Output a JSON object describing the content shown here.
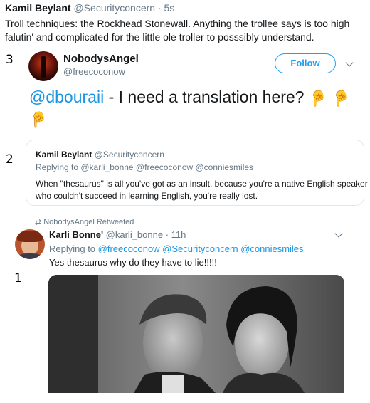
{
  "header": {
    "name": "Kamil Beylant",
    "handle": "@Securityconcern",
    "time": "· 5s",
    "text_line1": "Troll techniques: the Rockhead Stonewall.  Anything the trollee says is too high",
    "text_line2": "falutin' and complicated for the little ole troller to posssibly understand."
  },
  "tweet3": {
    "number": "3",
    "name": "NobodysAngel",
    "handle": "@freecoconow",
    "follow_label": "Follow",
    "mention": "@dbouraii",
    "text": " - I need a translation here?"
  },
  "tweet2": {
    "number": "2",
    "name": "Kamil Beylant",
    "handle": "@Securityconcern",
    "replying_prefix": "Replying to ",
    "replying_to": "@karli_bonne @freecoconow @conniesmiles",
    "text_line1": "When \"thesaurus\" is all you've got as an insult, because you're a native English speaker",
    "text_line2": "who couldn't succeed in learning English, you're really lost."
  },
  "tweet1": {
    "number": "1",
    "retweet_label": "NobodysAngel Retweeted",
    "name": "Karli Bonne'",
    "handle": "@karli_bonne",
    "time": "· 11h",
    "replying_prefix": "Replying to ",
    "replying_to": "@freecoconow @Securityconcern @conniesmiles",
    "text": "Yes thesaurus why do they have to lie!!!!!"
  },
  "icons": {
    "pointing": "☝",
    "retweet": "⇅"
  },
  "colors": {
    "link": "#1b95e0",
    "muted": "#657786",
    "follow": "#1da1f2",
    "emoji": "#f5a623"
  }
}
